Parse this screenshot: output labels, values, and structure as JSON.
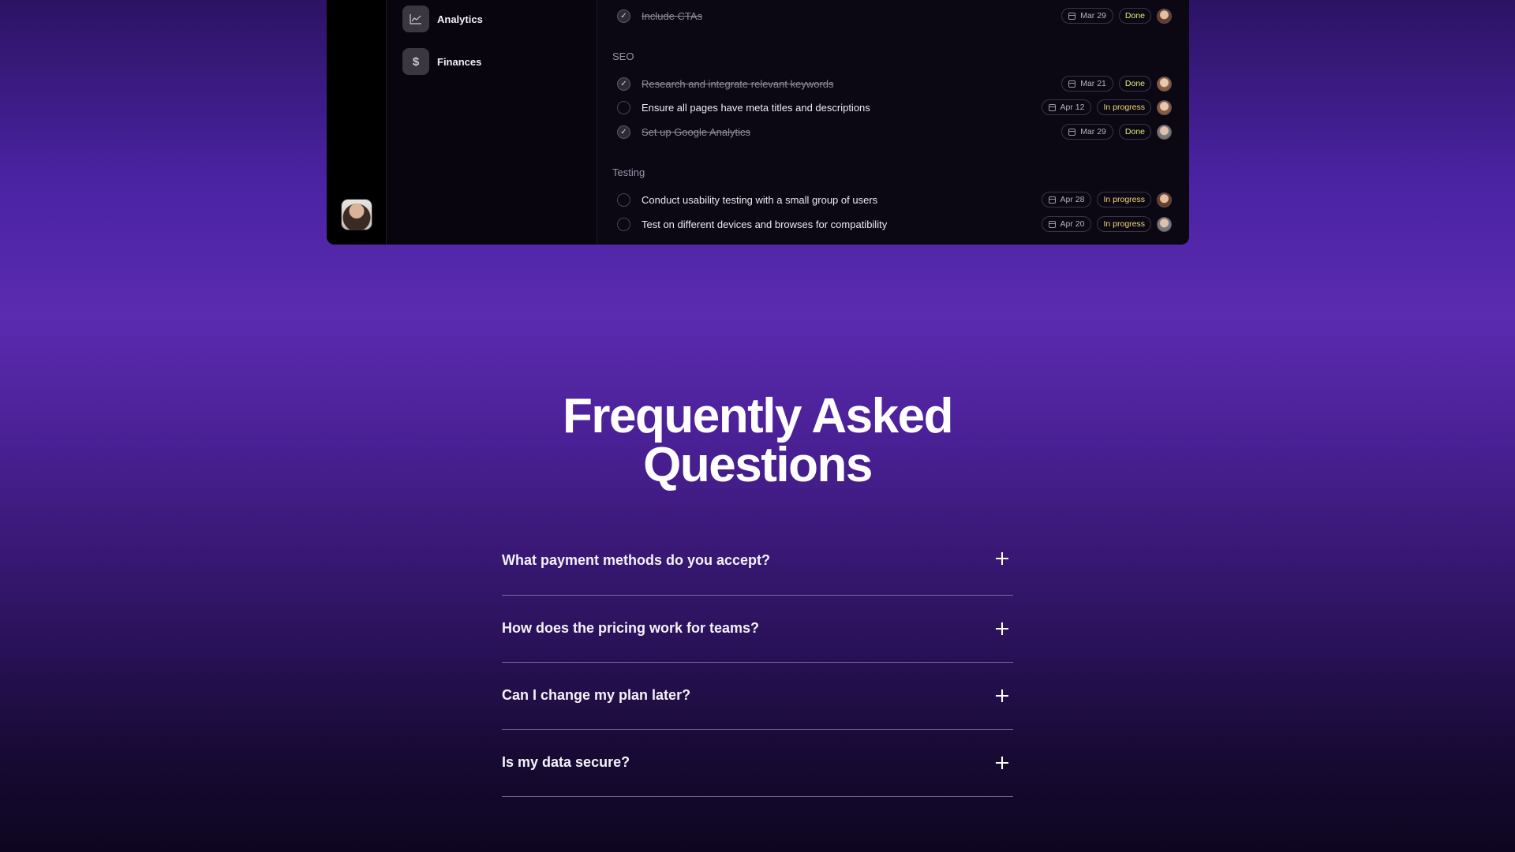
{
  "nav": {
    "items": [
      {
        "label": "Analytics",
        "icon": "chart-line-icon"
      },
      {
        "label": "Finances",
        "icon": "dollar-icon"
      }
    ]
  },
  "sections": [
    {
      "label": "SEO"
    },
    {
      "label": "Testing"
    }
  ],
  "tasks": [
    {
      "text": "Include CTAs",
      "date": "Mar 29",
      "status": "Done",
      "done": true
    },
    {
      "text": "Research and integrate relevant keywords",
      "date": "Mar 21",
      "status": "Done",
      "done": true
    },
    {
      "text": "Ensure all pages have meta titles and descriptions",
      "date": "Apr 12",
      "status": "In progress",
      "done": false
    },
    {
      "text": "Set up Google Analytics",
      "date": "Mar 29",
      "status": "Done",
      "done": true
    },
    {
      "text": "Conduct usability testing with a small group of users",
      "date": "Apr 28",
      "status": "In progress",
      "done": false
    },
    {
      "text": "Test on different devices and browses for compatibility",
      "date": "Apr 20",
      "status": "In progress",
      "done": false
    }
  ],
  "faq": {
    "title_line1": "Frequently Asked",
    "title_line2": "Questions",
    "questions": [
      "What payment methods do you accept?",
      "How does the pricing work for teams?",
      "Can I change my plan later?",
      "Is my data secure?"
    ]
  },
  "colors": {
    "status_done": "#d6f27a",
    "status_progress": "#f0d97a",
    "background_accent": "#5b2bb0"
  }
}
